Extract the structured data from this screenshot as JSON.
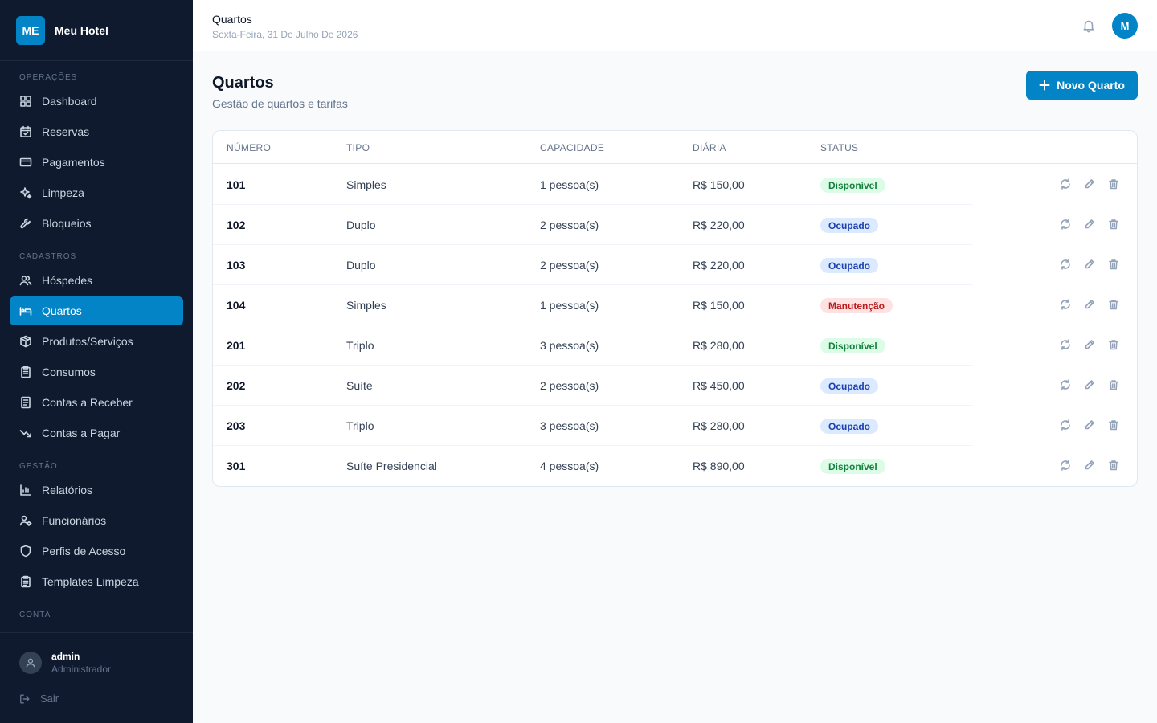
{
  "brand": {
    "logo_text": "ME",
    "name": "Meu Hotel"
  },
  "sidebar": {
    "sections": [
      {
        "label": "OPERAÇÕES"
      },
      {
        "label": "CADASTROS"
      },
      {
        "label": "GESTÃO"
      },
      {
        "label": "CONTA"
      }
    ],
    "items": [
      {
        "label": "Dashboard",
        "icon": "dashboard-icon"
      },
      {
        "label": "Reservas",
        "icon": "calendar-icon"
      },
      {
        "label": "Pagamentos",
        "icon": "credit-card-icon"
      },
      {
        "label": "Limpeza",
        "icon": "sparkles-icon"
      },
      {
        "label": "Bloqueios",
        "icon": "wrench-icon"
      },
      {
        "label": "Hóspedes",
        "icon": "users-icon"
      },
      {
        "label": "Quartos",
        "icon": "bed-icon",
        "active": true
      },
      {
        "label": "Produtos/Serviços",
        "icon": "package-icon"
      },
      {
        "label": "Consumos",
        "icon": "clipboard-icon"
      },
      {
        "label": "Contas a Receber",
        "icon": "receipt-icon"
      },
      {
        "label": "Contas a Pagar",
        "icon": "trending-down-icon"
      },
      {
        "label": "Relatórios",
        "icon": "bar-chart-icon"
      },
      {
        "label": "Funcionários",
        "icon": "user-cog-icon"
      },
      {
        "label": "Perfis de Acesso",
        "icon": "shield-icon"
      },
      {
        "label": "Templates Limpeza",
        "icon": "clipboard-list-icon"
      }
    ],
    "user": {
      "name": "admin",
      "role": "Administrador"
    },
    "logout_label": "Sair"
  },
  "topbar": {
    "title": "Quartos",
    "date": "Sexta-Feira, 31 De Julho De 2026",
    "avatar_initial": "M"
  },
  "page": {
    "title": "Quartos",
    "subtitle": "Gestão de quartos e tarifas",
    "new_button_label": "Novo Quarto"
  },
  "table": {
    "headers": [
      "NÚMERO",
      "TIPO",
      "CAPACIDADE",
      "DIÁRIA",
      "STATUS"
    ],
    "rows": [
      {
        "numero": "101",
        "tipo": "Simples",
        "capacidade": "1 pessoa(s)",
        "diaria": "R$ 150,00",
        "status": "Disponível",
        "status_kind": "disp"
      },
      {
        "numero": "102",
        "tipo": "Duplo",
        "capacidade": "2 pessoa(s)",
        "diaria": "R$ 220,00",
        "status": "Ocupado",
        "status_kind": "ocup"
      },
      {
        "numero": "103",
        "tipo": "Duplo",
        "capacidade": "2 pessoa(s)",
        "diaria": "R$ 220,00",
        "status": "Ocupado",
        "status_kind": "ocup"
      },
      {
        "numero": "104",
        "tipo": "Simples",
        "capacidade": "1 pessoa(s)",
        "diaria": "R$ 150,00",
        "status": "Manutenção",
        "status_kind": "manu"
      },
      {
        "numero": "201",
        "tipo": "Triplo",
        "capacidade": "3 pessoa(s)",
        "diaria": "R$ 280,00",
        "status": "Disponível",
        "status_kind": "disp"
      },
      {
        "numero": "202",
        "tipo": "Suíte",
        "capacidade": "2 pessoa(s)",
        "diaria": "R$ 450,00",
        "status": "Ocupado",
        "status_kind": "ocup"
      },
      {
        "numero": "203",
        "tipo": "Triplo",
        "capacidade": "3 pessoa(s)",
        "diaria": "R$ 280,00",
        "status": "Ocupado",
        "status_kind": "ocup"
      },
      {
        "numero": "301",
        "tipo": "Suíte Presidencial",
        "capacidade": "4 pessoa(s)",
        "diaria": "R$ 890,00",
        "status": "Disponível",
        "status_kind": "disp"
      }
    ]
  },
  "colors": {
    "sidebar_bg": "#0f1a2e",
    "accent": "#0284c7",
    "status_available": "#15803d",
    "status_occupied": "#1e40af",
    "status_maintenance": "#b91c1c"
  }
}
